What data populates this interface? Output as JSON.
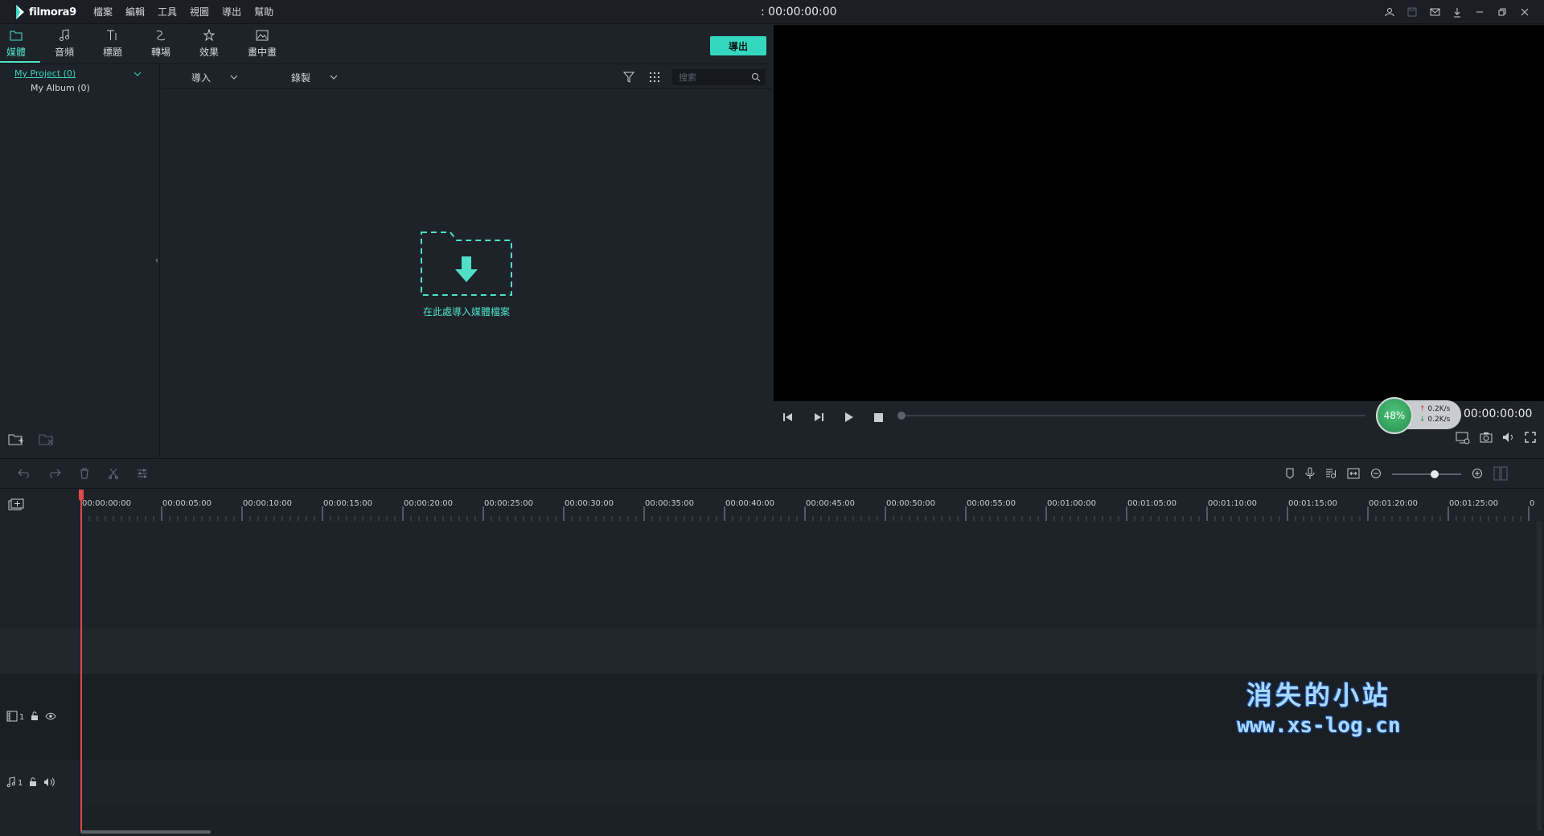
{
  "app": {
    "brand": "filmora9"
  },
  "menu": [
    "檔案",
    "編輯",
    "工具",
    "視圖",
    "導出",
    "幫助"
  ],
  "top_timecode": ": 00:00:00:00",
  "tabs": [
    {
      "label": "媒體",
      "icon": "folder-icon",
      "active": true
    },
    {
      "label": "音頻",
      "icon": "music-note-icon",
      "active": false
    },
    {
      "label": "標題",
      "icon": "text-title-icon",
      "active": false
    },
    {
      "label": "轉場",
      "icon": "transition-icon",
      "active": false
    },
    {
      "label": "效果",
      "icon": "effects-icon",
      "active": false
    },
    {
      "label": "畫中畫",
      "icon": "picture-icon",
      "active": false
    }
  ],
  "export_label": "導出",
  "sidebar": {
    "project": "My Project (0)",
    "album": "My Album (0)"
  },
  "media_toolbar": {
    "import_label": "導入",
    "record_label": "錄製",
    "search_placeholder": "搜索"
  },
  "drop_zone": {
    "text": "在此處導入媒體檔案"
  },
  "player": {
    "time": "00:00:00:00",
    "perf_percent": "48%",
    "upload_rate": "0.2K/s",
    "download_rate": "0.2K/s"
  },
  "ruler": {
    "labels": [
      "00:00:00:00",
      "00:00:05:00",
      "00:00:10:00",
      "00:00:15:00",
      "00:00:20:00",
      "00:00:25:00",
      "00:00:30:00",
      "00:00:35:00",
      "00:00:40:00",
      "00:00:45:00",
      "00:00:50:00",
      "00:00:55:00",
      "00:01:00:00",
      "00:01:05:00",
      "00:01:10:00",
      "00:01:15:00",
      "00:01:20:00",
      "00:01:25:00",
      "0"
    ]
  },
  "tracks": {
    "video_number": "1",
    "audio_number": "1"
  },
  "watermark": {
    "line1": "消失的小站",
    "line2": "www.xs-log.cn"
  },
  "colors": {
    "accent": "#34d8bf",
    "playhead": "#e24a4a",
    "background": "#1e2329"
  }
}
